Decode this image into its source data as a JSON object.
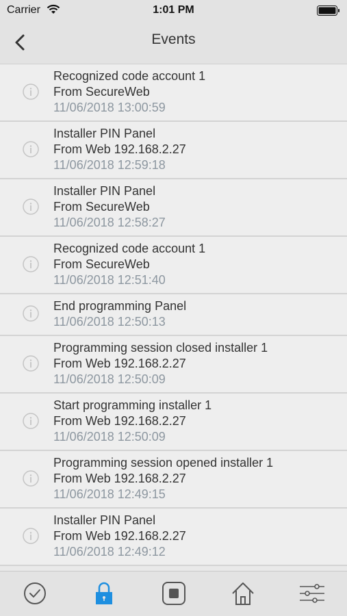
{
  "status_bar": {
    "carrier": "Carrier",
    "time": "1:01 PM",
    "icons": [
      "wifi-icon",
      "battery-icon"
    ]
  },
  "nav": {
    "title": "Events",
    "back_icon": "chevron-left-icon"
  },
  "events": [
    {
      "lines": [
        "Recognized code account 1",
        "From SecureWeb"
      ],
      "timestamp": "11/06/2018 13:00:59"
    },
    {
      "lines": [
        "Installer PIN Panel",
        "From Web 192.168.2.27"
      ],
      "timestamp": "11/06/2018 12:59:18"
    },
    {
      "lines": [
        "Installer PIN Panel",
        "From SecureWeb"
      ],
      "timestamp": "11/06/2018 12:58:27"
    },
    {
      "lines": [
        "Recognized code account 1",
        "From SecureWeb"
      ],
      "timestamp": "11/06/2018 12:51:40"
    },
    {
      "lines": [
        "End programming Panel"
      ],
      "timestamp": "11/06/2018 12:50:13"
    },
    {
      "lines": [
        "Programming session closed installer 1",
        "From Web 192.168.2.27"
      ],
      "timestamp": "11/06/2018 12:50:09"
    },
    {
      "lines": [
        "Start programming installer 1",
        "From Web 192.168.2.27"
      ],
      "timestamp": "11/06/2018 12:50:09"
    },
    {
      "lines": [
        "Programming session opened installer 1",
        "From Web 192.168.2.27"
      ],
      "timestamp": "11/06/2018 12:49:15"
    },
    {
      "lines": [
        "Installer PIN Panel",
        "From Web 192.168.2.27"
      ],
      "timestamp": "11/06/2018 12:49:12"
    }
  ],
  "tabs": [
    {
      "icon": "checkmark-circle-icon",
      "active": false
    },
    {
      "icon": "lock-icon",
      "active": true
    },
    {
      "icon": "stop-square-icon",
      "active": false
    },
    {
      "icon": "home-icon",
      "active": false
    },
    {
      "icon": "sliders-icon",
      "active": false
    }
  ],
  "colors": {
    "accent": "#1e8fe0",
    "timestamp": "#8d97a0",
    "icon_gray": "#555555"
  }
}
